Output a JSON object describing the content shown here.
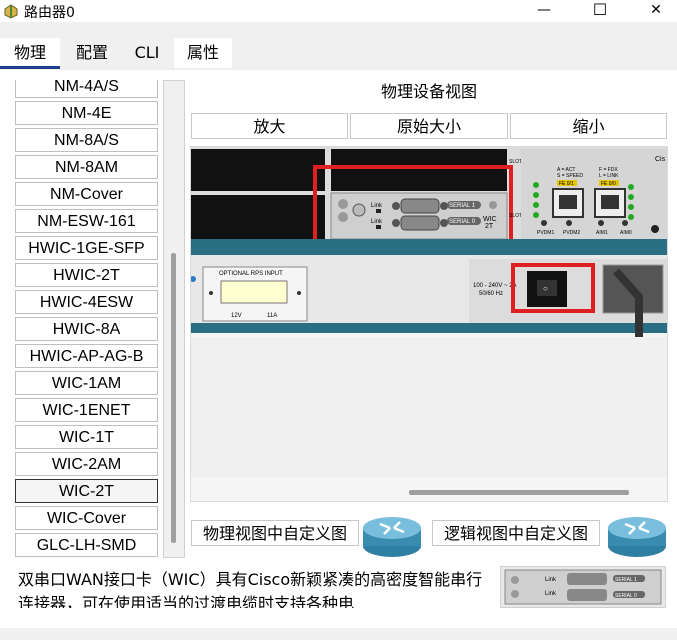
{
  "window": {
    "title": "路由器0",
    "minimize_glyph": "—",
    "maximize_glyph": "☐",
    "close_glyph": "✕"
  },
  "tabs": [
    {
      "label": "物理",
      "active": true
    },
    {
      "label": "配置",
      "active": false
    },
    {
      "label": "CLI",
      "active": false
    },
    {
      "label": "属性",
      "active": false
    }
  ],
  "module_list": {
    "items": [
      {
        "label": "NM-4A/S"
      },
      {
        "label": "NM-4E"
      },
      {
        "label": "NM-8A/S"
      },
      {
        "label": "NM-8AM"
      },
      {
        "label": "NM-Cover"
      },
      {
        "label": "NM-ESW-161"
      },
      {
        "label": "HWIC-1GE-SFP"
      },
      {
        "label": "HWIC-2T"
      },
      {
        "label": "HWIC-4ESW"
      },
      {
        "label": "HWIC-8A"
      },
      {
        "label": "HWIC-AP-AG-B"
      },
      {
        "label": "WIC-1AM"
      },
      {
        "label": "WIC-1ENET"
      },
      {
        "label": "WIC-1T"
      },
      {
        "label": "WIC-2AM"
      },
      {
        "label": "WIC-2T",
        "selected": true
      },
      {
        "label": "WIC-Cover"
      },
      {
        "label": "GLC-LH-SMD"
      }
    ]
  },
  "physical_view": {
    "title": "物理设备视图",
    "zoom_in_label": "放大",
    "original_size_label": "原始大小",
    "zoom_out_label": "缩小",
    "device_labels": {
      "slot0": "S\nL\nO\nT\n0",
      "slot1": "S\nL\nO\nT\n1",
      "link1": "Link",
      "link0": "Link",
      "serial1": "SERIAL 1",
      "serial0": "SERIAL 0",
      "wic2t": "WIC\n2T",
      "act_speed": "A = ACT\nS = SPEED",
      "fdx_link": "F = FDX\nL = LINK",
      "fe01": "FE 0/1",
      "fe00": "FE 0/0",
      "pvdm1": "PVDM1",
      "pvdm2": "PVDM2",
      "aim1": "AIM1",
      "aim0": "AIM0",
      "rps_title": "OPTIONAL RPS INPUT",
      "rps_volts": "12V",
      "rps_amps": "11A",
      "power_rating": "100 - 240V ~ 2A\n50/60 Hz",
      "brand": "Cis"
    },
    "highlight_color": "#e02020"
  },
  "customize_physical_label": "物理视图中自定义图",
  "customize_logical_label": "逻辑视图中自定义图",
  "description": "双串口WAN接口卡（WIC）具有Cisco新颖紧凑的高密度智能串行连接器，可在使用适当的过渡电缆时支持各种电",
  "colors": {
    "tab_underline": "#1e3d8f",
    "router_blue": "#3a8bb0",
    "teal_stripe": "#2a6e82"
  }
}
